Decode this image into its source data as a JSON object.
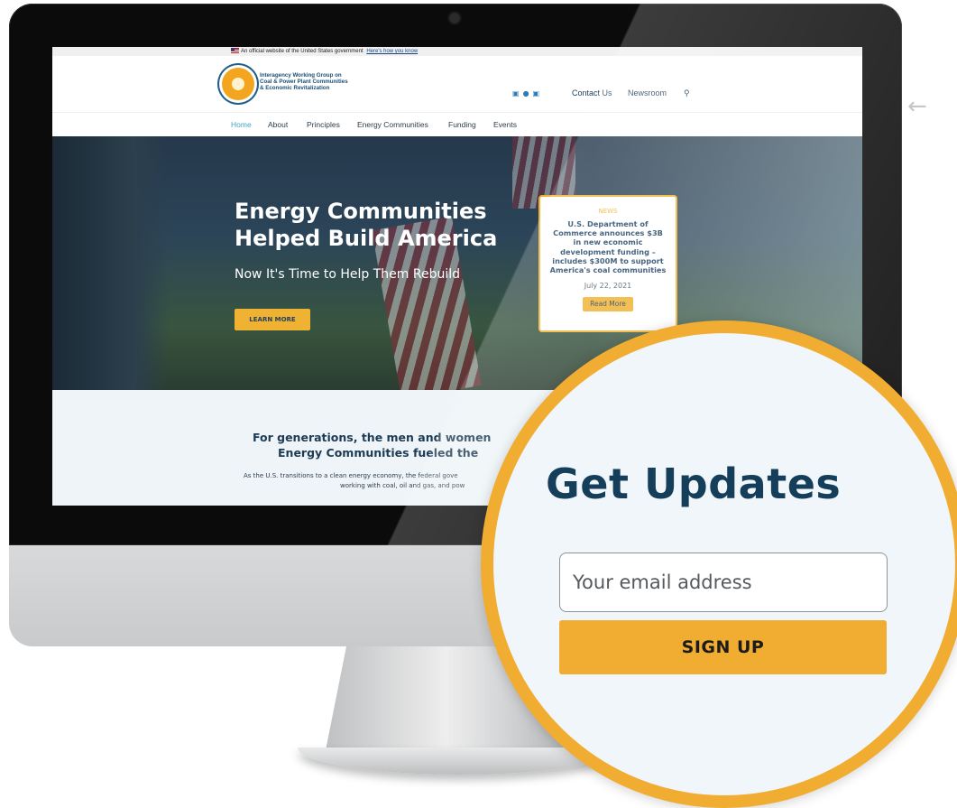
{
  "gov_banner": {
    "text": "An official website of the United States government",
    "link": "Here's how you know"
  },
  "header": {
    "logo_line1": "Interagency Working Group on",
    "logo_line2": "Coal & Power Plant Communities",
    "logo_line3": "& Economic Revitalization",
    "social_icons": [
      "facebook-icon",
      "twitter-icon",
      "linkedin-icon"
    ],
    "contact": "Contact Us",
    "newsroom": "Newsroom",
    "search_icon": "search-icon"
  },
  "nav": {
    "items": [
      "Home",
      "About",
      "Principles",
      "Energy Communities",
      "Funding",
      "Events"
    ],
    "active": "Home"
  },
  "hero": {
    "title_line1": "Energy Communities",
    "title_line2": "Helped Build America",
    "subtitle": "Now It's Time to Help Them Rebuild",
    "button": "LEARN MORE"
  },
  "news": {
    "tag": "NEWS",
    "headline": "U.S. Department of Commerce announces $3B in new economic development funding – includes $300M to support America's coal communities",
    "date": "July 22, 2021",
    "button": "Read More"
  },
  "intro": {
    "title_line1": "For generations, the men and women",
    "title_line2": "Energy Communities fueled the",
    "body_line1": "As the U.S. transitions to a clean energy economy, the federal gove",
    "body_line2": "working with coal, oil and gas, and pow"
  },
  "signup": {
    "title": "Get Updates",
    "email_placeholder": "Your email address",
    "button": "SIGN UP"
  },
  "colors": {
    "accent": "#f1ad32",
    "navy": "#153e5a",
    "nav_active": "#3ea6c8"
  }
}
